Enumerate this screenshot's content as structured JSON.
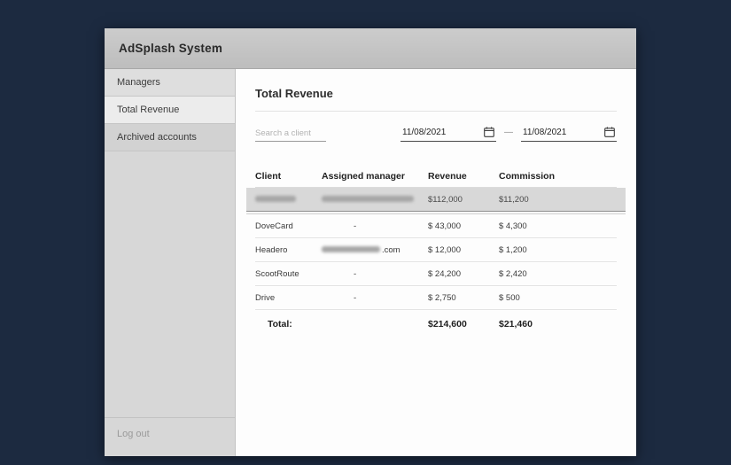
{
  "app": {
    "title": "AdSplash System"
  },
  "sidebar": {
    "items": [
      {
        "label": "Managers"
      },
      {
        "label": "Total Revenue"
      },
      {
        "label": "Archived accounts"
      }
    ],
    "logout_label": "Log out"
  },
  "main": {
    "title": "Total Revenue",
    "search": {
      "placeholder": "Search a client"
    },
    "dates": {
      "from": "11/08/2021",
      "separator": "—",
      "to": "11/08/2021"
    },
    "table": {
      "headers": [
        "Client",
        "Assigned manager",
        "Revenue",
        "Commission"
      ],
      "rows": [
        {
          "client": "",
          "client_redacted": true,
          "manager": "",
          "manager_redacted": true,
          "revenue": "$112,000",
          "commission": "$11,200",
          "highlighted": true
        },
        {
          "client": "DoveCard",
          "manager": "-",
          "revenue": "$ 43,000",
          "commission": "$ 4,300"
        },
        {
          "client": "Headero",
          "manager_redacted": true,
          "manager_visible": ".com",
          "revenue": "$ 12,000",
          "commission": "$ 1,200"
        },
        {
          "client": "ScootRoute",
          "manager": "-",
          "revenue": "$ 24,200",
          "commission": "$ 2,420"
        },
        {
          "client": "Drive",
          "manager": "-",
          "revenue": "$ 2,750",
          "commission": "$ 500"
        }
      ],
      "total_label": "Total:",
      "total_revenue": "$214,600",
      "total_commission": "$21,460"
    }
  }
}
